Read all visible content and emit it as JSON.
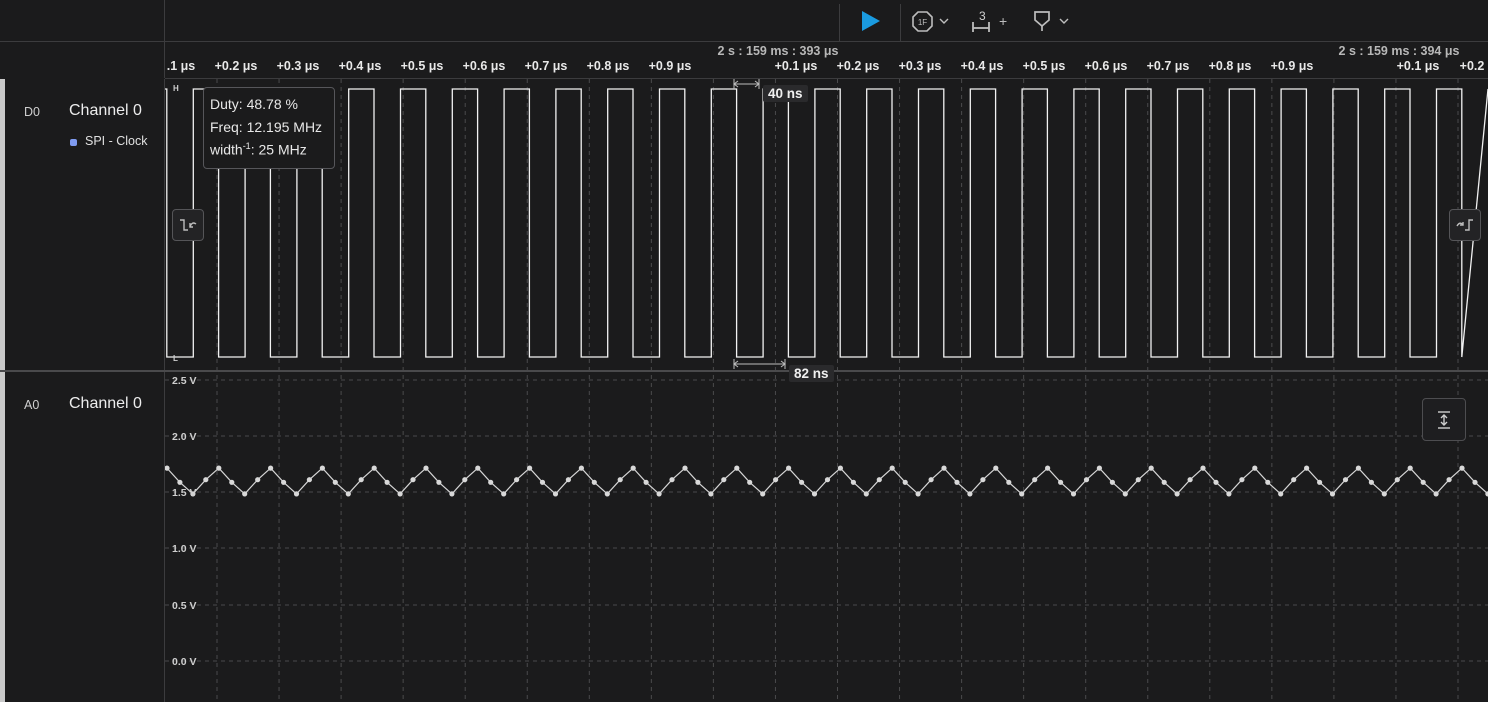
{
  "toolbar": {
    "play_icon": "play-icon",
    "trigger_icon": "trigger-icon",
    "measure_count": "3",
    "measure_plus": "+",
    "marker_icon": "marker-icon",
    "accent_color": "#1a9be0"
  },
  "timeline": {
    "abs_times": [
      {
        "label": "2 s : 159 ms : 393 μs"
      },
      {
        "label": "2 s : 159 ms : 394 μs"
      }
    ],
    "ticks": [
      ".1 μs",
      "+0.2 μs",
      "+0.3 μs",
      "+0.4 μs",
      "+0.5 μs",
      "+0.6 μs",
      "+0.7 μs",
      "+0.8 μs",
      "+0.9 μs",
      "+0.1 μs",
      "+0.2 μs",
      "+0.3 μs",
      "+0.4 μs",
      "+0.5 μs",
      "+0.6 μs",
      "+0.7 μs",
      "+0.8 μs",
      "+0.9 μs",
      "+0.1 μs",
      "+0.2"
    ]
  },
  "channels": [
    {
      "id": "D0",
      "name": "Channel 0",
      "analyzer": "SPI - Clock",
      "analyzer_color": "#7f9bf0",
      "high_label": "H",
      "low_label": "L"
    },
    {
      "id": "A0",
      "name": "Channel 0"
    }
  ],
  "measurement": {
    "duty": "Duty: 48.78 %",
    "freq": "Freq: 12.195 MHz",
    "width_prefix": "width",
    "width_exp": "-1",
    "width_value": ": 25 MHz",
    "pulse_width": "40 ns",
    "period": "82 ns"
  },
  "analog_axis": [
    "2.5 V",
    "2.0 V",
    "1.5 V",
    "1.0 V",
    "0.5 V",
    "0.0 V"
  ],
  "nav_buttons": {
    "prev_edge_icon": "prev-edge-icon",
    "next_edge_icon": "next-edge-icon",
    "autoscale_icon": "autoscale-icon"
  }
}
